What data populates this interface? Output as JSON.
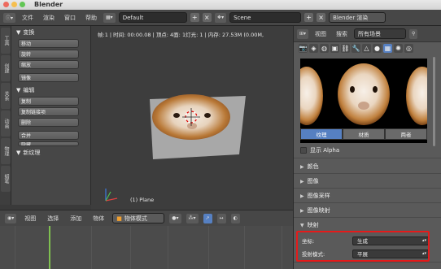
{
  "window": {
    "title": "Blender"
  },
  "info_header": {
    "menus": [
      "文件",
      "渲染",
      "窗口",
      "帮助"
    ],
    "layout_field": "Default",
    "scene_field": "Scene",
    "engine_field": "Blender 渲染"
  },
  "viewport": {
    "stats": "帧:1 | 时间: 00:00.08 | 顶点: 4面: 1灯光: 1 | 内存: 27.53M (0.00M,",
    "object_label": "(1) Plane"
  },
  "tool_shelf": {
    "tabs": [
      "工具",
      "创建",
      "关系",
      "动画",
      "物理",
      "蜡笔"
    ],
    "transform_header": "变换",
    "transform_buttons": [
      "移动",
      "旋转",
      "缩放",
      "镜像"
    ],
    "edit_header": "编辑",
    "edit_buttons": [
      "复制",
      "复制链接项",
      "删除",
      "合并",
      "隐藏"
    ],
    "new_texture_header": "新纹理"
  },
  "timeline_header": {
    "menus": [
      "视图",
      "选择",
      "添加",
      "物体"
    ],
    "mode": "物体模式"
  },
  "properties": {
    "header_menus": [
      "视图",
      "搜索"
    ],
    "scope": "所有场景",
    "tabs": [
      "纹理",
      "材质",
      "两者"
    ],
    "show_alpha": "显示 Alpha",
    "panels": [
      "颜色",
      "图像",
      "图像采样",
      "图像映射"
    ],
    "mapping_header": "映射",
    "coords_label": "坐标:",
    "coords_value": "生成",
    "projection_label": "投射模式:",
    "projection_value": "平展"
  },
  "colors": {
    "accent": "#5680c2",
    "highlight": "#e51a1a"
  }
}
